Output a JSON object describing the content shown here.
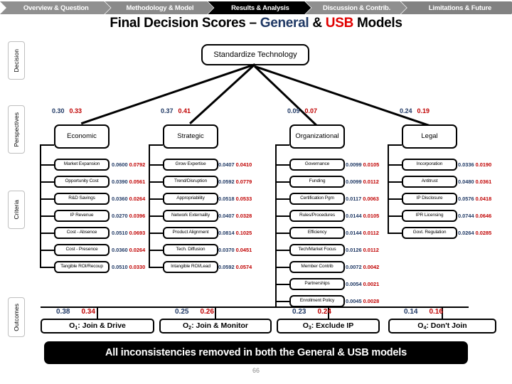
{
  "nav": {
    "tabs": [
      {
        "label": "Overview & Question",
        "active": false
      },
      {
        "label": "Methodology & Model",
        "active": false
      },
      {
        "label": "Results & Analysis",
        "active": true
      },
      {
        "label": "Discussion & Contrib.",
        "active": false
      },
      {
        "label": "Limitations & Future",
        "active": false
      }
    ]
  },
  "title": {
    "part1": "Final Decision Scores – ",
    "general": "General",
    "amp": " & ",
    "usb": "USB",
    "part2": " Models"
  },
  "row_labels": {
    "decision": "Decision",
    "perspectives": "Perspectives",
    "criteria": "Criteria",
    "outcomes": "Outcomes"
  },
  "legend": {
    "general_color": "#1F3864",
    "usb_color": "#C00000"
  },
  "decision_node": {
    "label": "Standardize Technology"
  },
  "perspectives": [
    {
      "label": "Economic",
      "general": "0.30",
      "usb": "0.33"
    },
    {
      "label": "Strategic",
      "general": "0.37",
      "usb": "0.41"
    },
    {
      "label": "Organizational",
      "general": "0.09",
      "usb": "0.07"
    },
    {
      "label": "Legal",
      "general": "0.24",
      "usb": "0.19"
    }
  ],
  "criteria": {
    "economic": [
      {
        "label": "Market Expansion",
        "general": "0.0600",
        "usb": "0.0792"
      },
      {
        "label": "Opportunity Cost",
        "general": "0.0390",
        "usb": "0.0561"
      },
      {
        "label": "R&D Savings",
        "general": "0.0360",
        "usb": "0.0264"
      },
      {
        "label": "IP Revenue",
        "general": "0.0270",
        "usb": "0.0396"
      },
      {
        "label": "Cost - Absence",
        "general": "0.0510",
        "usb": "0.0693"
      },
      {
        "label": "Cost - Presence",
        "general": "0.0360",
        "usb": "0.0264"
      },
      {
        "label": "Tangible ROI/Recoup",
        "general": "0.0510",
        "usb": "0.0330"
      }
    ],
    "strategic": [
      {
        "label": "Grow Expertise",
        "general": "0.0407",
        "usb": "0.0410"
      },
      {
        "label": "Trend/Disruption",
        "general": "0.0592",
        "usb": "0.0779"
      },
      {
        "label": "Appropriability",
        "general": "0.0518",
        "usb": "0.0533"
      },
      {
        "label": "Network Externality",
        "general": "0.0407",
        "usb": "0.0328"
      },
      {
        "label": "Product Alignment",
        "general": "0.0814",
        "usb": "0.1025"
      },
      {
        "label": "Tech. Diffusion",
        "general": "0.0370",
        "usb": "0.0451"
      },
      {
        "label": "Intangible ROI/Lead",
        "general": "0.0592",
        "usb": "0.0574"
      }
    ],
    "organizational": [
      {
        "label": "Governance",
        "general": "0.0099",
        "usb": "0.0105"
      },
      {
        "label": "Funding",
        "general": "0.0099",
        "usb": "0.0112"
      },
      {
        "label": "Certification Pgm",
        "general": "0.0117",
        "usb": "0.0063"
      },
      {
        "label": "Rules/Procedures",
        "general": "0.0144",
        "usb": "0.0105"
      },
      {
        "label": "Efficiency",
        "general": "0.0144",
        "usb": "0.0112"
      },
      {
        "label": "Tech/Market Focus",
        "general": "0.0126",
        "usb": "0.0112"
      },
      {
        "label": "Member Contrib",
        "general": "0.0072",
        "usb": "0.0042"
      },
      {
        "label": "Partnerships",
        "general": "0.0054",
        "usb": "0.0021"
      },
      {
        "label": "Enrollment Policy",
        "general": "0.0045",
        "usb": "0.0028"
      }
    ],
    "legal": [
      {
        "label": "Incorporation",
        "general": "0.0336",
        "usb": "0.0190"
      },
      {
        "label": "Antitrust",
        "general": "0.0480",
        "usb": "0.0361"
      },
      {
        "label": "IP Disclosure",
        "general": "0.0576",
        "usb": "0.0418"
      },
      {
        "label": "IPR Licensing",
        "general": "0.0744",
        "usb": "0.0646"
      },
      {
        "label": "Govt. Regulation",
        "general": "0.0264",
        "usb": "0.0285"
      }
    ]
  },
  "outcomes": [
    {
      "id": "O",
      "sub": "1",
      "label": ": Join & Drive",
      "general": "0.38",
      "usb": "0.34"
    },
    {
      "id": "O",
      "sub": "2",
      "label": ": Join & Monitor",
      "general": "0.25",
      "usb": "0.26"
    },
    {
      "id": "O",
      "sub": "3",
      "label": ": Exclude IP",
      "general": "0.23",
      "usb": "0.24"
    },
    {
      "id": "O",
      "sub": "4",
      "label": ": Don't Join",
      "general": "0.14",
      "usb": "0.16"
    }
  ],
  "banner": {
    "text": "All inconsistencies removed in both the General & USB models"
  },
  "page_number": "66"
}
